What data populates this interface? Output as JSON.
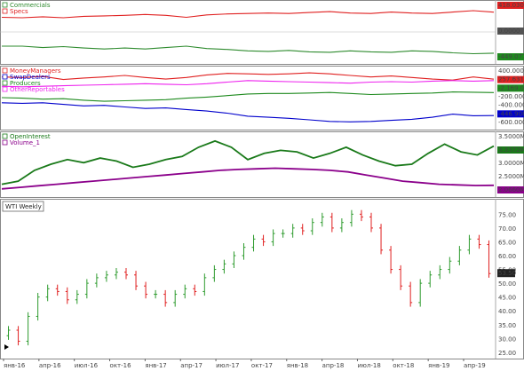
{
  "colors": {
    "commercials": "#2e8b2e",
    "specs": "#e02020",
    "money_managers": "#e02020",
    "swap_dealers": "#0000cc",
    "producers": "#1e8a1e",
    "other_reportables": "#ee22ee",
    "open_interest": "#1a7a1a",
    "volume": "#8b008b",
    "candle_up": "#2e9b2e",
    "candle_down": "#e02020",
    "badge_dark": "#222222"
  },
  "panel1": {
    "legend": [
      "Commercials",
      "Specs"
    ],
    "axis": [
      {
        "text": "418.0300",
        "badge": true,
        "color": "#e02020"
      },
      {
        "text": "0.0000",
        "badge": true,
        "color": "#555555"
      },
      {
        "text": "-449.0770",
        "badge": true,
        "color": "#1e8a1e"
      }
    ]
  },
  "panel2": {
    "legend": [
      "MoneyManagers",
      "SwapDealers",
      "Producers",
      "OtherReportables"
    ],
    "axis": [
      {
        "text": "400.0000K",
        "badge": false,
        "color": ""
      },
      {
        "text": "257.6310K",
        "badge": true,
        "color": "#e02020"
      },
      {
        "text": "-2.169.000K",
        "badge": true,
        "color": "#1e8a1e"
      },
      {
        "text": "-200.0000K",
        "badge": false,
        "color": ""
      },
      {
        "text": "-400.0000K",
        "badge": false,
        "color": ""
      },
      {
        "text": "-446.9080K",
        "badge": true,
        "color": "#0000cc"
      },
      {
        "text": "-600.0000K",
        "badge": false,
        "color": ""
      }
    ]
  },
  "panel3": {
    "legend": [
      "OpenInterest",
      "Volume_1"
    ],
    "axis": [
      {
        "text": "3.5000M",
        "badge": false,
        "color": ""
      },
      {
        "text": "3.3372M",
        "badge": true,
        "color": "#1a7a1a"
      },
      {
        "text": "3.0000M",
        "badge": false,
        "color": ""
      },
      {
        "text": "2.5000M",
        "badge": false,
        "color": ""
      },
      {
        "text": "2.0660M",
        "badge": true,
        "color": "#8b008b"
      }
    ]
  },
  "panel4": {
    "title": "WTI Weekly",
    "last_price": "53.50",
    "y_ticks": [
      "75.00",
      "70.00",
      "65.00",
      "60.00",
      "55.00",
      "50.00",
      "45.00",
      "40.00",
      "35.00",
      "30.00",
      "25.00"
    ]
  },
  "x_labels": [
    "янв-16",
    "апр-16",
    "июл-16",
    "окт-16",
    "янв-17",
    "апр-17",
    "июл-17",
    "окт-17",
    "янв-18",
    "апр-18",
    "июл-18",
    "окт-18",
    "янв-19",
    "апр-19"
  ],
  "chart_data": [
    {
      "type": "line",
      "series": [
        {
          "name": "Commercials",
          "values": [
            -300,
            -300,
            -330,
            -310,
            -340,
            -360,
            -340,
            -360,
            -330,
            -300,
            -350,
            -370,
            -400,
            -410,
            -390,
            -420,
            -430,
            -400,
            -420,
            -430,
            -400,
            -410,
            -440,
            -460,
            -449
          ]
        },
        {
          "name": "Specs",
          "values": [
            310,
            300,
            320,
            300,
            330,
            340,
            350,
            370,
            350,
            310,
            360,
            380,
            390,
            400,
            390,
            410,
            430,
            400,
            390,
            420,
            400,
            390,
            420,
            450,
            418
          ]
        }
      ],
      "ylim": [
        -600,
        600
      ]
    },
    {
      "type": "line",
      "series": [
        {
          "name": "MoneyManagers",
          "values": [
            300,
            290,
            310,
            250,
            280,
            300,
            330,
            290,
            260,
            290,
            340,
            370,
            360,
            350,
            360,
            380,
            360,
            330,
            300,
            320,
            290,
            260,
            240,
            300,
            257.631
          ]
        },
        {
          "name": "SwapDealers",
          "values": [
            -200,
            -210,
            -200,
            -230,
            -260,
            -250,
            -280,
            -310,
            -300,
            -330,
            -360,
            -400,
            -460,
            -480,
            -500,
            -530,
            -560,
            -570,
            -560,
            -540,
            -520,
            -480,
            -420,
            -450,
            -446.908
          ]
        },
        {
          "name": "Producers",
          "values": [
            -100,
            -110,
            -130,
            -120,
            -150,
            -170,
            -160,
            -150,
            -140,
            -110,
            -90,
            -60,
            -30,
            -20,
            -20,
            -10,
            0,
            -20,
            -40,
            -30,
            -20,
            -10,
            10,
            5,
            -2.169
          ]
        },
        {
          "name": "OtherReportables",
          "values": [
            120,
            110,
            120,
            130,
            140,
            150,
            160,
            170,
            160,
            150,
            170,
            200,
            230,
            220,
            210,
            200,
            190,
            180,
            200,
            210,
            200,
            220,
            230,
            220,
            230
          ]
        }
      ],
      "ylim": [
        -650,
        450
      ]
    },
    {
      "type": "line",
      "series": [
        {
          "name": "OpenInterest",
          "values": [
            2.1,
            2.2,
            2.55,
            2.75,
            2.9,
            2.8,
            2.95,
            2.85,
            2.65,
            2.75,
            2.9,
            3.0,
            3.3,
            3.5,
            3.3,
            2.9,
            3.1,
            3.2,
            3.15,
            2.95,
            3.1,
            3.3,
            3.05,
            2.85,
            2.7,
            2.75,
            3.1,
            3.4,
            3.15,
            3.05,
            3.3372
          ]
        },
        {
          "name": "Volume_1",
          "values": [
            1.95,
            2.0,
            2.05,
            2.1,
            2.15,
            2.2,
            2.25,
            2.3,
            2.35,
            2.4,
            2.45,
            2.5,
            2.55,
            2.58,
            2.6,
            2.62,
            2.6,
            2.58,
            2.55,
            2.5,
            2.4,
            2.3,
            2.2,
            2.15,
            2.1,
            2.08,
            2.06,
            2.066
          ]
        }
      ],
      "ylim": [
        1.8,
        3.7
      ]
    },
    {
      "type": "line",
      "title": "WTI Weekly",
      "x": [
        "янв-16",
        "апр-16",
        "июл-16",
        "окт-16",
        "янв-17",
        "апр-17",
        "июл-17",
        "окт-17",
        "янв-18",
        "апр-18",
        "июл-18",
        "окт-18",
        "янв-19",
        "апр-19"
      ],
      "series": [
        {
          "name": "",
          "values": [
            33,
            29,
            38,
            45,
            48,
            47,
            44,
            46,
            50,
            52,
            53,
            54,
            53,
            49,
            46,
            46,
            43,
            46,
            48,
            47,
            52,
            55,
            57,
            60,
            63,
            66,
            65,
            68,
            68,
            70,
            69,
            72,
            74,
            70,
            72,
            75,
            74,
            70,
            62,
            55,
            49,
            43,
            50,
            53,
            55,
            58,
            62,
            66,
            64,
            53.5
          ]
        }
      ],
      "ylim": [
        24,
        78
      ]
    }
  ]
}
